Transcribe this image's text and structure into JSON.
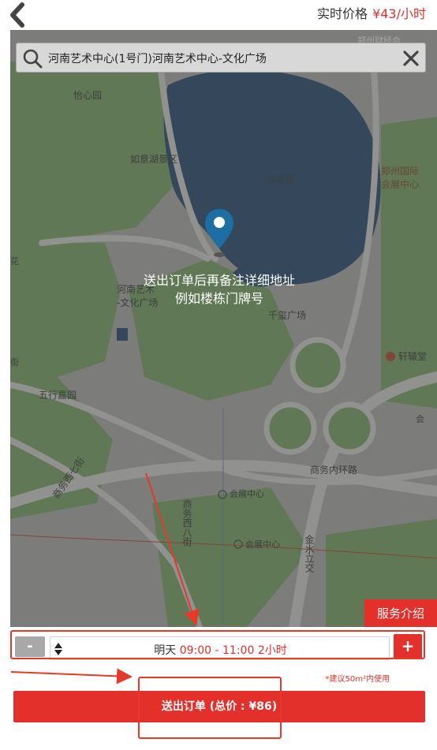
{
  "header": {
    "back_icon": "chevron-left-icon",
    "price_label": "实时价格",
    "price_value": "¥43/小时"
  },
  "search": {
    "value": "河南艺术中心(1号门)河南艺术中心-文化广场",
    "icons": [
      "search-icon",
      "close-icon"
    ]
  },
  "map": {
    "hint_line1": "送出订单后再备注详细地址",
    "hint_line2": "例如楼栋门牌号",
    "labels": {
      "yixinyuan": "怡心园",
      "ruyihu_scenic": "如意湖景区",
      "ruyihu": "如意湖",
      "zhengzhou_expo_1": "郑州国际",
      "zhengzhou_expo_2": "会展中心",
      "henan_art_1": "河南艺术",
      "henan_art_2": "-文化广场",
      "qianxi_square": "千玺广场",
      "xuanyuantang": "轩辕堂",
      "wuxing_garden": "五行嘉园",
      "shangwu_west7": "商务西七街",
      "shangwu_inner_ring": "商务内环路",
      "huizhan_center_1": "会展中心",
      "huizhan_center_2": "会展中心",
      "shangwu_west8": "商务西八街",
      "jinshui_overpass": "金水立交",
      "flower": "花",
      "jie": "街",
      "hui": "会",
      "top_right_fragment": "郑州财经会"
    }
  },
  "service_button": "服务介绍",
  "booking": {
    "minus_label": "-",
    "plus_label": "+",
    "day": "明天",
    "time_range": "09:00 - 11:00",
    "duration": "2小时",
    "note": "*建议50m²内使用",
    "submit_label": "送出订单 (总价 : ¥86)"
  },
  "colors": {
    "accent": "#e4302b",
    "map_water": "#3d5a80",
    "map_green": "#7fae6c",
    "map_road": "#c4c4c4"
  }
}
